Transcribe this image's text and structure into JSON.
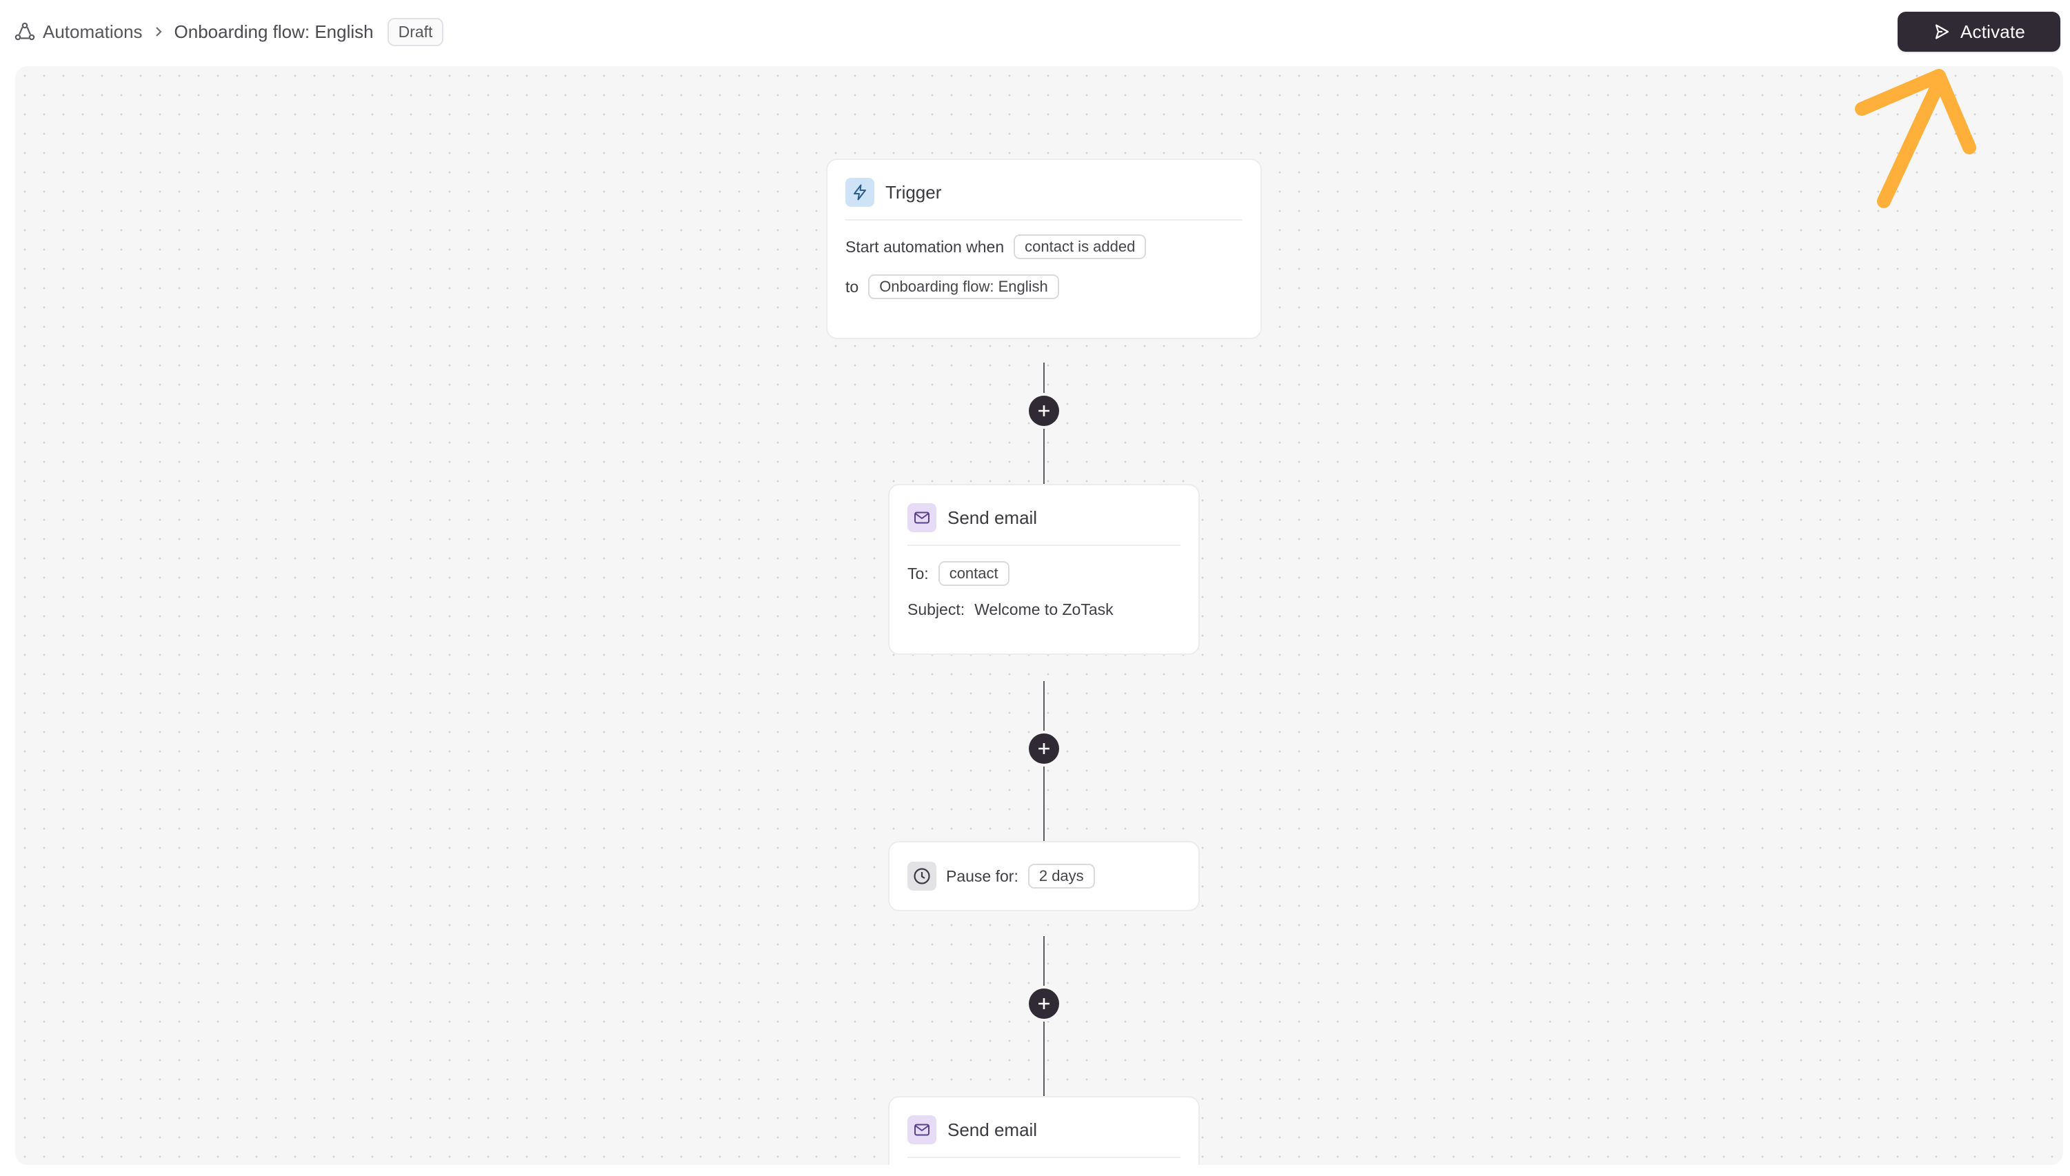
{
  "breadcrumb": {
    "root": "Automations",
    "current": "Onboarding flow: English",
    "status": "Draft"
  },
  "toolbar": {
    "activate_label": "Activate"
  },
  "trigger": {
    "title": "Trigger",
    "line1_prefix": "Start automation when",
    "event": "contact is added",
    "line2_prefix": "to",
    "list": "Onboarding flow: English"
  },
  "step1": {
    "title": "Send email",
    "to_label": "To:",
    "to_value": "contact",
    "subject_label": "Subject:",
    "subject_value": "Welcome to ZoTask"
  },
  "step2": {
    "label": "Pause for:",
    "value": "2 days"
  },
  "step3": {
    "title": "Send email"
  },
  "icons": {
    "breadcrumb": "automations-icon",
    "separator": "chevron-right-icon",
    "activate": "play-icon",
    "trigger": "lightning-icon",
    "email": "mail-icon",
    "pause": "clock-icon",
    "add": "plus-icon"
  },
  "colors": {
    "primary_button": "#2f2a33",
    "canvas": "#f6f6f6",
    "annotation_arrow": "#ffb03b",
    "trigger_icon_bg": "#cfe3f7",
    "email_icon_bg": "#e6dcf6"
  }
}
